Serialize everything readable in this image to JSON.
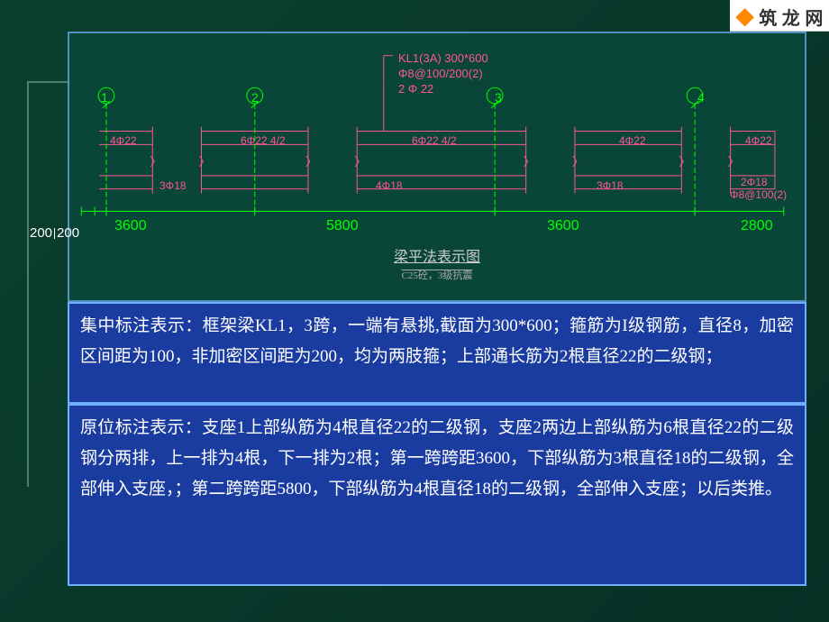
{
  "watermark": "筑 龙 网",
  "beam_label": {
    "line1": "KL1(3A) 300*600",
    "line2": "Φ8@100/200(2)",
    "line3": "2 Φ 22"
  },
  "axes": [
    "1",
    "2",
    "3",
    "4"
  ],
  "top_rebar": {
    "left": "4Φ22",
    "axis2": "6Φ22  4/2",
    "axis2_right": "6Φ22  4/2",
    "axis3_right": "4Φ22",
    "cantilever": "4Φ22"
  },
  "bottom_rebar": {
    "span1": "3Φ18",
    "span2": "4Φ18",
    "span3": "3Φ18",
    "cantilever_top": "2Φ18",
    "cantilever_bot": "Φ8@100(2)"
  },
  "spans": {
    "left_off1": "200",
    "left_off2": "200",
    "s1": "3600",
    "s2": "5800",
    "s3": "3600",
    "s4": "2800"
  },
  "figure": {
    "title": "梁平法表示图",
    "subtitle": "C25砼，3级抗震"
  },
  "desc1": "集中标注表示：框架梁KL1，3跨，一端有悬挑,截面为300*600；箍筋为I级钢筋，直径8，加密区间距为100，非加密区间距为200，均为两肢箍；上部通长筋为2根直径22的二级钢；",
  "desc2": "原位标注表示：支座1上部纵筋为4根直径22的二级钢，支座2两边上部纵筋为6根直径22的二级钢分两排，上一排为4根，下一排为2根；第一跨跨距3600，下部纵筋为3根直径18的二级钢，全部伸入支座，；第二跨跨距5800，下部纵筋为4根直径18的二级钢，全部伸入支座；以后类推。"
}
